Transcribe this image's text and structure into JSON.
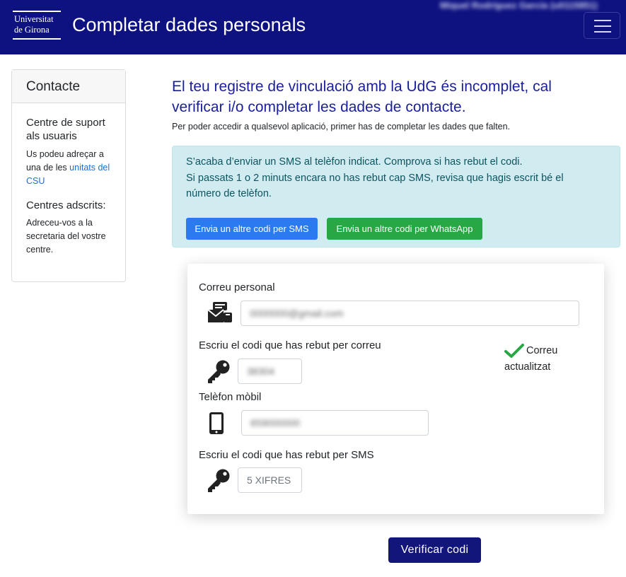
{
  "header": {
    "logo_line1": "Universitat",
    "logo_line2": "de Girona",
    "title": "Completar dades personals",
    "user_name": "Miquel Rodríguez García (u0115851)",
    "menu_icon": "hamburger-icon",
    "bg_color": "#0e1180"
  },
  "sidebar": {
    "heading": "Contacte",
    "support_title": "Centre de suport als usuaris",
    "support_text": "Us podeu adreçar a una de les",
    "support_link": "unitats del CSU",
    "adscrits_title": "Centres adscrits:",
    "adscrits_text": "Adreceu-vos a la secretaria del vostre centre."
  },
  "main": {
    "title": "El teu registre de vinculació amb la UdG és incomplet, cal verificar i/o completar les dades de contacte.",
    "subtitle": "Per poder accedir a qualsevol aplicació, primer has de completar les dades que falten."
  },
  "alert": {
    "line1": "S’acaba d’enviar un SMS al telèfon indicat. Comprova si has rebut el codi.",
    "line2": "Si passats 1 o 2 minuts encara no has rebut cap SMS, revisa que hagis escrit bé el",
    "line3": "número de telèfon.",
    "sms_button": "Envia un altre codi per SMS",
    "whatsapp_button": "Envia un altre codi per WhatsApp"
  },
  "form": {
    "email_label": "Correu personal",
    "email_value": "0000000@gmail.com",
    "email_code_label": "Escriu el codi que has rebut per correu",
    "email_code_value": "38304",
    "status_line1": "Correu",
    "status_line2": "actualitzat",
    "phone_label": "Telèfon mòbil",
    "phone_value": "659000000",
    "sms_code_label": "Escriu el codi que has rebut per SMS",
    "sms_code_placeholder": "5 XIFRES",
    "icons": {
      "email": "mail-icon",
      "key": "key-icon",
      "phone": "mobile-phone-icon",
      "check": "check-icon"
    }
  },
  "actions": {
    "verify_button": "Verificar codi"
  },
  "colors": {
    "primary": "#0e1180",
    "heading": "#1a1f9c",
    "info_bg": "#d1ecf1",
    "sms_button": "#2a7bf0",
    "whatsapp_button": "#28a745",
    "check": "#28a745"
  }
}
